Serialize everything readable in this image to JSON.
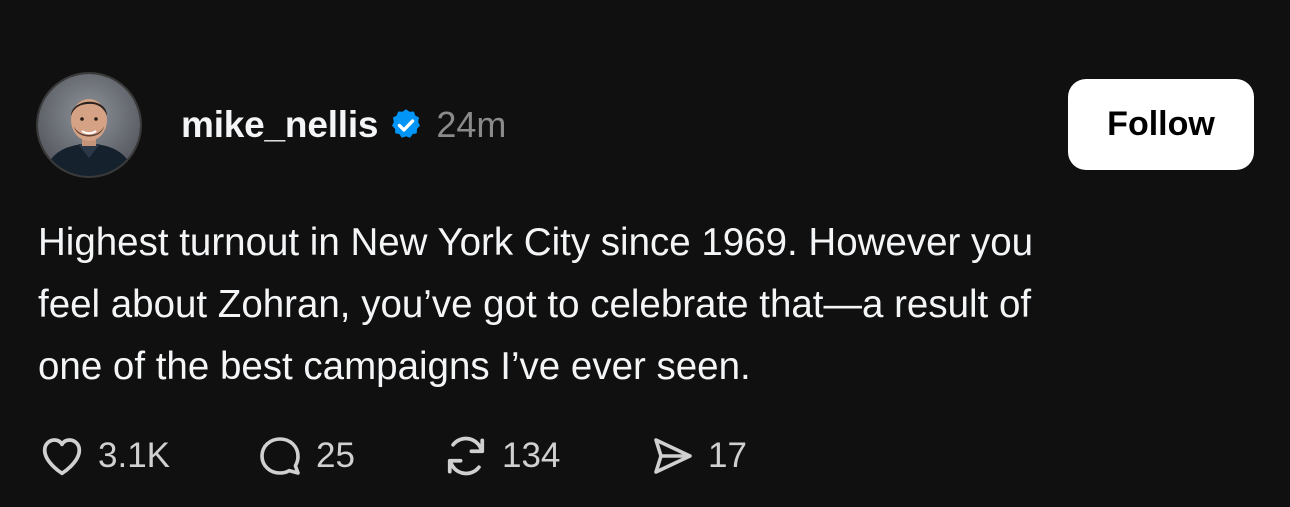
{
  "post": {
    "author": {
      "username": "mike_nellis",
      "verified_icon": "verified-badge-icon",
      "time": "24m"
    },
    "follow_label": "Follow",
    "text_lines": [
      "Highest turnout in New York City since 1969. However you",
      "feel about Zohran, you’ve got to celebrate that—a result of",
      "one of the best campaigns I’ve ever seen."
    ],
    "actions": {
      "likes": "3.1K",
      "replies": "25",
      "reposts": "134",
      "shares": "17"
    }
  },
  "colors": {
    "background": "#101010",
    "text": "#f3f5f7",
    "secondary_text": "#8a8a8a",
    "verified": "#0095f6",
    "follow_button_bg": "#ffffff"
  }
}
